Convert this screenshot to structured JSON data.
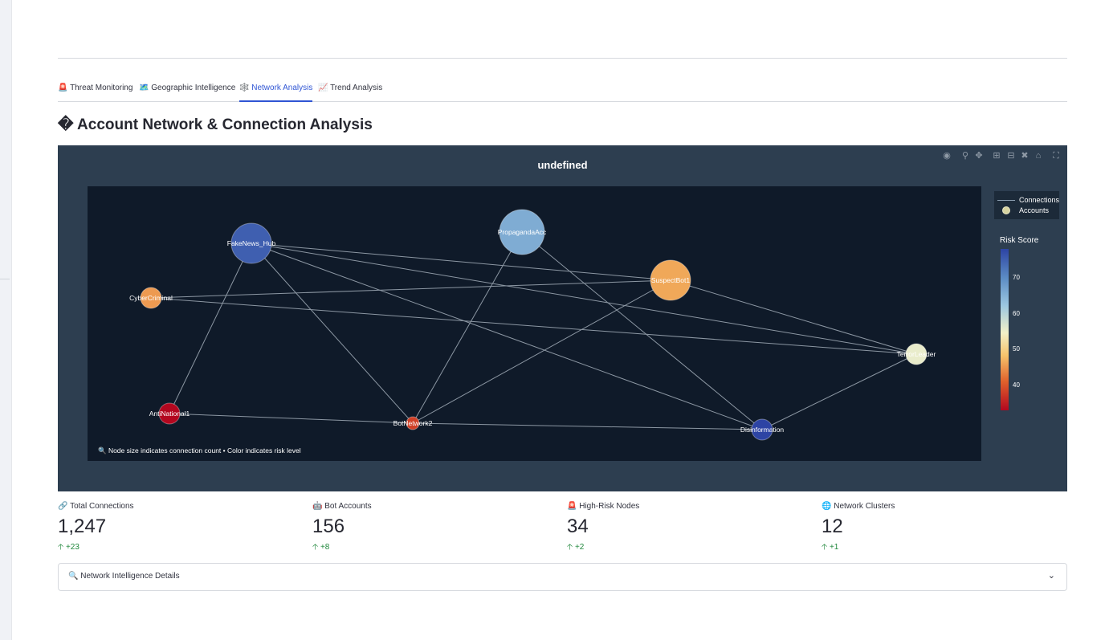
{
  "tabs": [
    {
      "icon": "🚨",
      "label": "Threat Monitoring",
      "active": false
    },
    {
      "icon": "🗺️",
      "label": "Geographic Intelligence",
      "active": false
    },
    {
      "icon": "🕸️",
      "label": "Network Analysis",
      "active": true
    },
    {
      "icon": "📈",
      "label": "Trend Analysis",
      "active": false
    }
  ],
  "section": {
    "title": "� Account Network & Connection Analysis"
  },
  "chart": {
    "title": "undefined",
    "modebar": [
      "camera-icon",
      "zoom-icon",
      "pan-icon",
      "zoom-in-icon",
      "zoom-out-icon",
      "autoscale-icon",
      "home-icon",
      "fullscreen-icon"
    ],
    "legend": {
      "connections": "Connections",
      "accounts": "Accounts"
    },
    "colorbar": {
      "title": "Risk Score",
      "ticks": [
        "70",
        "60",
        "50",
        "40"
      ],
      "colors": [
        "#2d44a4",
        "#9cc7e0",
        "#f3f1c8",
        "#e0622c",
        "#b3071f"
      ]
    },
    "caption": "🔍 Node size indicates connection count • Color indicates risk level"
  },
  "chart_data": {
    "type": "scatter",
    "title": "undefined",
    "colorbar_title": "Risk Score",
    "colorbar_range": [
      33,
      77
    ],
    "legend": [
      "Connections",
      "Accounts"
    ],
    "nodes": [
      {
        "name": "FakeNews_Hub",
        "risk": 74,
        "size": "large"
      },
      {
        "name": "PropagandaAcc",
        "risk": 65,
        "size": "largest"
      },
      {
        "name": "SuspectBot1",
        "risk": 46,
        "size": "large"
      },
      {
        "name": "CyberCriminal",
        "risk": 45,
        "size": "small"
      },
      {
        "name": "TerrorLeader",
        "risk": 55,
        "size": "small"
      },
      {
        "name": "AntiNational1",
        "risk": 33,
        "size": "small"
      },
      {
        "name": "BotNetwork2",
        "risk": 38,
        "size": "smallest"
      },
      {
        "name": "Disinformation",
        "risk": 77,
        "size": "small"
      }
    ],
    "edges": [
      [
        "FakeNews_Hub",
        "SuspectBot1"
      ],
      [
        "FakeNews_Hub",
        "TerrorLeader"
      ],
      [
        "FakeNews_Hub",
        "Disinformation"
      ],
      [
        "FakeNews_Hub",
        "BotNetwork2"
      ],
      [
        "FakeNews_Hub",
        "AntiNational1"
      ],
      [
        "PropagandaAcc",
        "BotNetwork2"
      ],
      [
        "PropagandaAcc",
        "Disinformation"
      ],
      [
        "CyberCriminal",
        "SuspectBot1"
      ],
      [
        "CyberCriminal",
        "TerrorLeader"
      ],
      [
        "SuspectBot1",
        "TerrorLeader"
      ],
      [
        "SuspectBot1",
        "BotNetwork2"
      ],
      [
        "AntiNational1",
        "BotNetwork2"
      ],
      [
        "BotNetwork2",
        "Disinformation"
      ],
      [
        "Disinformation",
        "TerrorLeader"
      ]
    ]
  },
  "metrics": [
    {
      "icon": "🔗",
      "label": "Total Connections",
      "value": "1,247",
      "delta": "+23"
    },
    {
      "icon": "🤖",
      "label": "Bot Accounts",
      "value": "156",
      "delta": "+8"
    },
    {
      "icon": "🚨",
      "label": "High-Risk Nodes",
      "value": "34",
      "delta": "+2"
    },
    {
      "icon": "🌐",
      "label": "Network Clusters",
      "value": "12",
      "delta": "+1"
    }
  ],
  "expander": {
    "label": "🔍 Network Intelligence Details",
    "chevron": "⌄"
  }
}
